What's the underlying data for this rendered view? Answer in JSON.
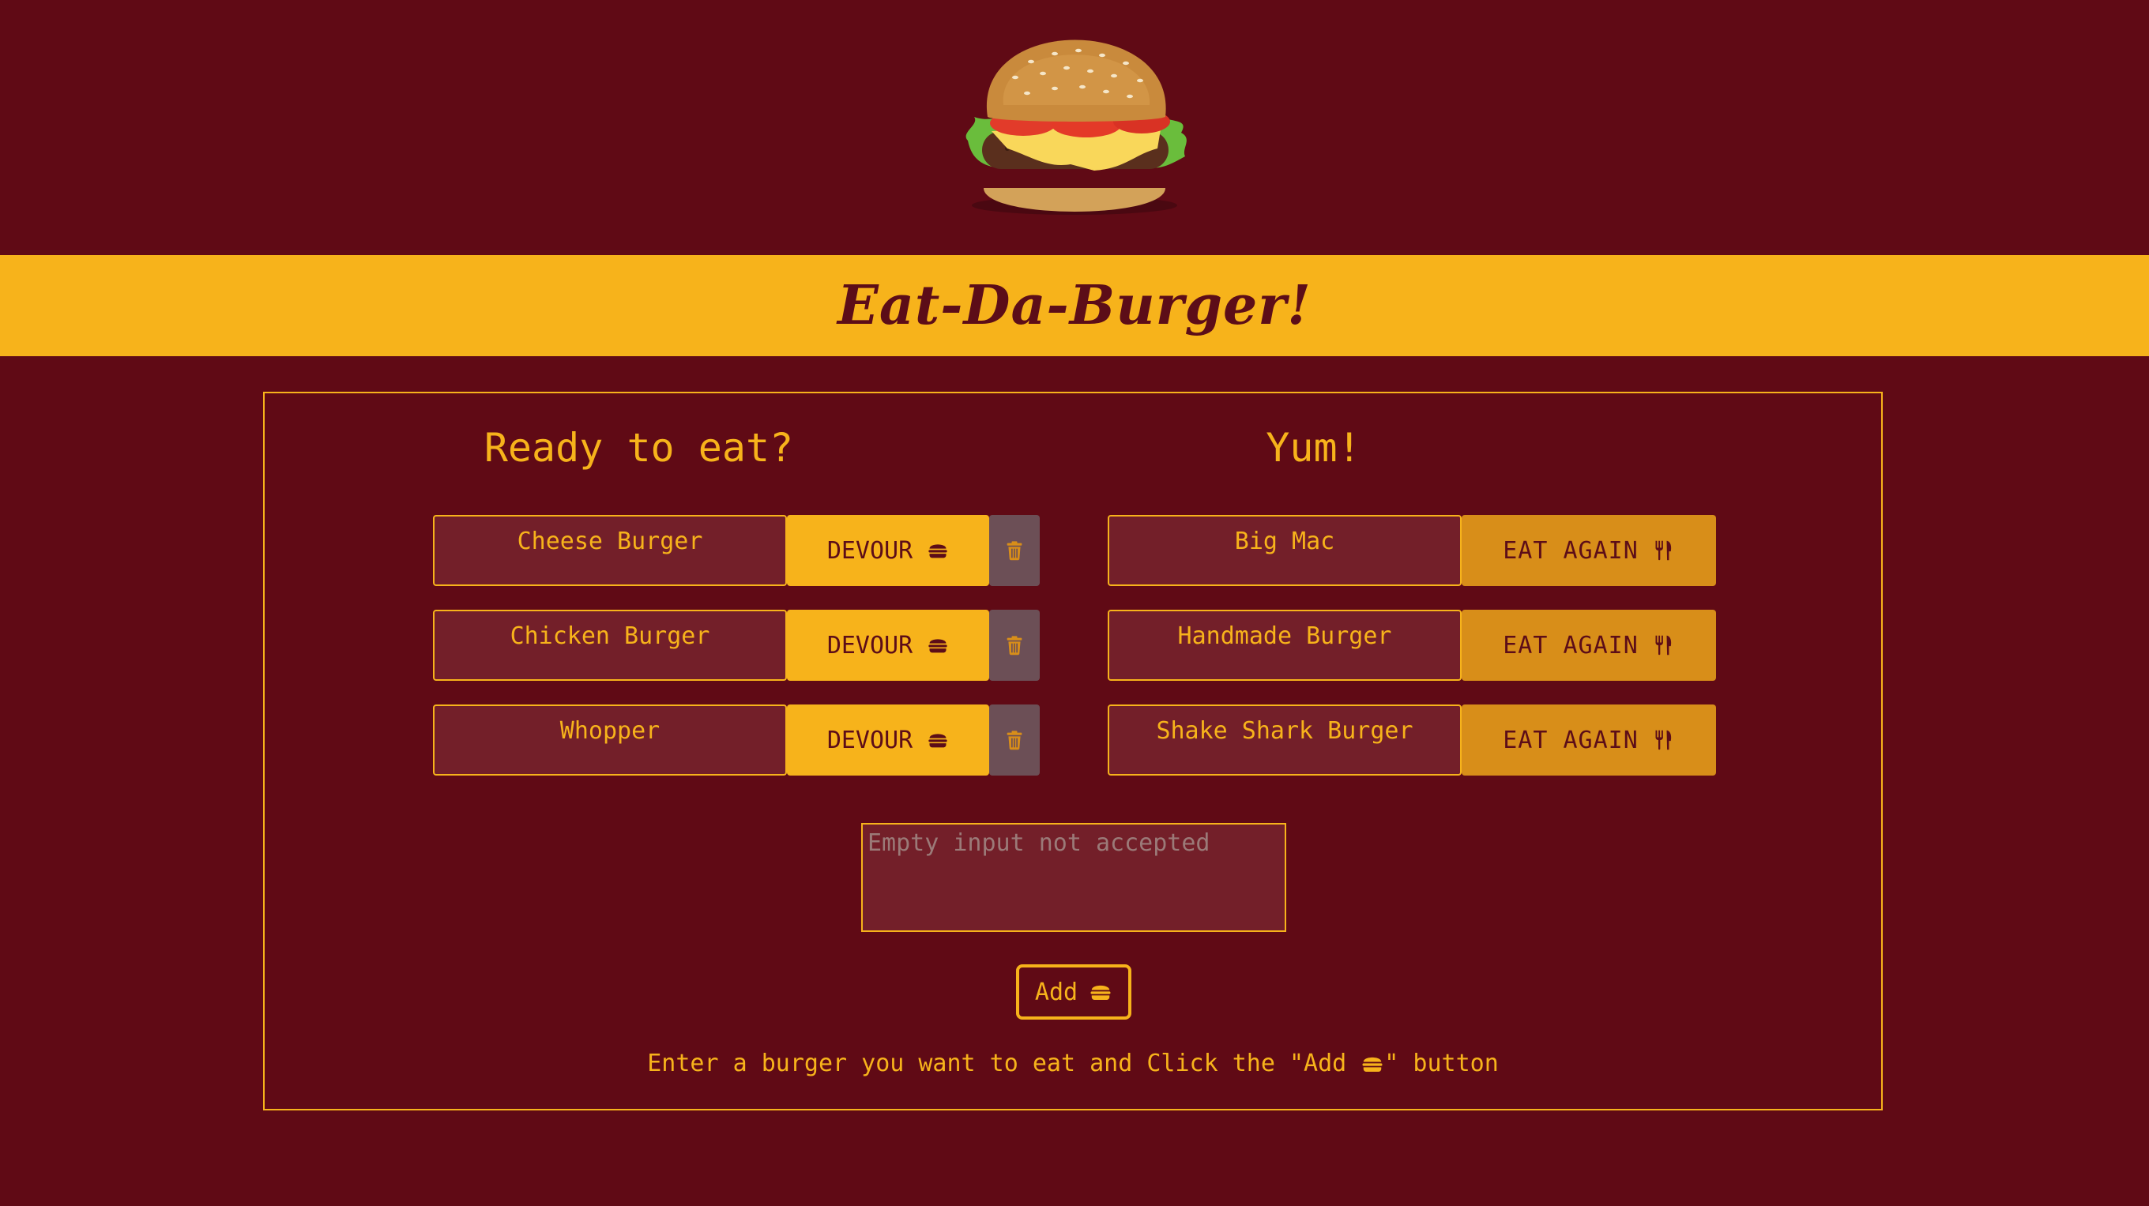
{
  "header": {
    "title": "Eat-Da-Burger!",
    "logo_icon": "burger-image"
  },
  "colors": {
    "background": "#600a15",
    "accent": "#f7b31b",
    "eat_again": "#d88e19",
    "trash": "#6c4f56",
    "name_box": "#731f29"
  },
  "ready": {
    "title": "Ready to eat?",
    "devour_label": "DEVOUR",
    "items": [
      {
        "name": "Cheese Burger"
      },
      {
        "name": "Chicken Burger"
      },
      {
        "name": "Whopper"
      }
    ]
  },
  "eaten": {
    "title": "Yum!",
    "eat_again_label": "EAT AGAIN",
    "items": [
      {
        "name": "Big Mac"
      },
      {
        "name": "Handmade Burger"
      },
      {
        "name": "Shake Shark Burger"
      }
    ]
  },
  "form": {
    "placeholder": "Empty input not accepted",
    "value": "",
    "add_label": "Add",
    "hint_before": "Enter a burger you want to eat and Click the \"Add ",
    "hint_after": "\" button"
  }
}
